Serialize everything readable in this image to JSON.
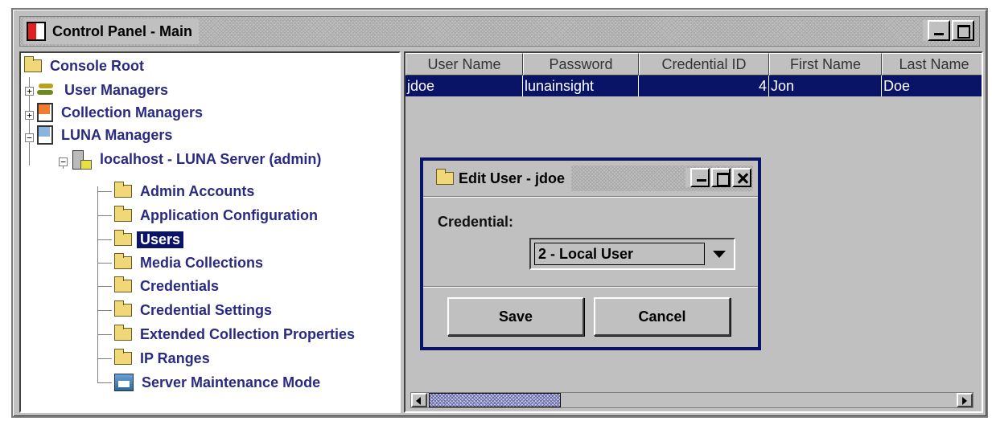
{
  "window": {
    "title": "Control Panel - Main"
  },
  "tree": {
    "root": "Console Root",
    "user_managers": "User Managers",
    "collection_managers": "Collection Managers",
    "luna_managers": "LUNA Managers",
    "server": "localhost - LUNA Server (admin)",
    "children": [
      "Admin Accounts",
      "Application Configuration",
      "Users",
      "Media Collections",
      "Credentials",
      "Credential Settings",
      "Extended Collection Properties",
      "IP Ranges",
      "Server Maintenance Mode"
    ],
    "selected": "Users"
  },
  "table": {
    "columns": [
      "User Name",
      "Password",
      "Credential ID",
      "First Name",
      "Last Name"
    ],
    "rows": [
      [
        "jdoe",
        "lunainsight",
        "4",
        "Jon",
        "Doe"
      ]
    ]
  },
  "dialog": {
    "title": "Edit User - jdoe",
    "credential_label": "Credential:",
    "credential_value": "2 - Local User",
    "save_label": "Save",
    "cancel_label": "Cancel"
  },
  "colors": {
    "selection": "#0a1466",
    "tree_text": "#2a2a80",
    "panel": "#c0c0c0"
  }
}
